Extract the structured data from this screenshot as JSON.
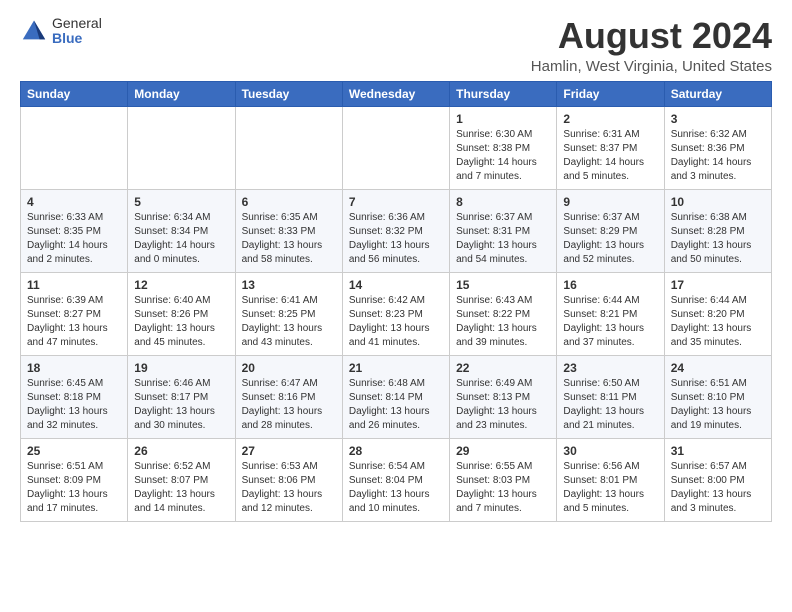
{
  "header": {
    "logo_general": "General",
    "logo_blue": "Blue",
    "month_title": "August 2024",
    "location": "Hamlin, West Virginia, United States"
  },
  "weekdays": [
    "Sunday",
    "Monday",
    "Tuesday",
    "Wednesday",
    "Thursday",
    "Friday",
    "Saturday"
  ],
  "weeks": [
    [
      {
        "day": "",
        "info": ""
      },
      {
        "day": "",
        "info": ""
      },
      {
        "day": "",
        "info": ""
      },
      {
        "day": "",
        "info": ""
      },
      {
        "day": "1",
        "info": "Sunrise: 6:30 AM\nSunset: 8:38 PM\nDaylight: 14 hours\nand 7 minutes."
      },
      {
        "day": "2",
        "info": "Sunrise: 6:31 AM\nSunset: 8:37 PM\nDaylight: 14 hours\nand 5 minutes."
      },
      {
        "day": "3",
        "info": "Sunrise: 6:32 AM\nSunset: 8:36 PM\nDaylight: 14 hours\nand 3 minutes."
      }
    ],
    [
      {
        "day": "4",
        "info": "Sunrise: 6:33 AM\nSunset: 8:35 PM\nDaylight: 14 hours\nand 2 minutes."
      },
      {
        "day": "5",
        "info": "Sunrise: 6:34 AM\nSunset: 8:34 PM\nDaylight: 14 hours\nand 0 minutes."
      },
      {
        "day": "6",
        "info": "Sunrise: 6:35 AM\nSunset: 8:33 PM\nDaylight: 13 hours\nand 58 minutes."
      },
      {
        "day": "7",
        "info": "Sunrise: 6:36 AM\nSunset: 8:32 PM\nDaylight: 13 hours\nand 56 minutes."
      },
      {
        "day": "8",
        "info": "Sunrise: 6:37 AM\nSunset: 8:31 PM\nDaylight: 13 hours\nand 54 minutes."
      },
      {
        "day": "9",
        "info": "Sunrise: 6:37 AM\nSunset: 8:29 PM\nDaylight: 13 hours\nand 52 minutes."
      },
      {
        "day": "10",
        "info": "Sunrise: 6:38 AM\nSunset: 8:28 PM\nDaylight: 13 hours\nand 50 minutes."
      }
    ],
    [
      {
        "day": "11",
        "info": "Sunrise: 6:39 AM\nSunset: 8:27 PM\nDaylight: 13 hours\nand 47 minutes."
      },
      {
        "day": "12",
        "info": "Sunrise: 6:40 AM\nSunset: 8:26 PM\nDaylight: 13 hours\nand 45 minutes."
      },
      {
        "day": "13",
        "info": "Sunrise: 6:41 AM\nSunset: 8:25 PM\nDaylight: 13 hours\nand 43 minutes."
      },
      {
        "day": "14",
        "info": "Sunrise: 6:42 AM\nSunset: 8:23 PM\nDaylight: 13 hours\nand 41 minutes."
      },
      {
        "day": "15",
        "info": "Sunrise: 6:43 AM\nSunset: 8:22 PM\nDaylight: 13 hours\nand 39 minutes."
      },
      {
        "day": "16",
        "info": "Sunrise: 6:44 AM\nSunset: 8:21 PM\nDaylight: 13 hours\nand 37 minutes."
      },
      {
        "day": "17",
        "info": "Sunrise: 6:44 AM\nSunset: 8:20 PM\nDaylight: 13 hours\nand 35 minutes."
      }
    ],
    [
      {
        "day": "18",
        "info": "Sunrise: 6:45 AM\nSunset: 8:18 PM\nDaylight: 13 hours\nand 32 minutes."
      },
      {
        "day": "19",
        "info": "Sunrise: 6:46 AM\nSunset: 8:17 PM\nDaylight: 13 hours\nand 30 minutes."
      },
      {
        "day": "20",
        "info": "Sunrise: 6:47 AM\nSunset: 8:16 PM\nDaylight: 13 hours\nand 28 minutes."
      },
      {
        "day": "21",
        "info": "Sunrise: 6:48 AM\nSunset: 8:14 PM\nDaylight: 13 hours\nand 26 minutes."
      },
      {
        "day": "22",
        "info": "Sunrise: 6:49 AM\nSunset: 8:13 PM\nDaylight: 13 hours\nand 23 minutes."
      },
      {
        "day": "23",
        "info": "Sunrise: 6:50 AM\nSunset: 8:11 PM\nDaylight: 13 hours\nand 21 minutes."
      },
      {
        "day": "24",
        "info": "Sunrise: 6:51 AM\nSunset: 8:10 PM\nDaylight: 13 hours\nand 19 minutes."
      }
    ],
    [
      {
        "day": "25",
        "info": "Sunrise: 6:51 AM\nSunset: 8:09 PM\nDaylight: 13 hours\nand 17 minutes."
      },
      {
        "day": "26",
        "info": "Sunrise: 6:52 AM\nSunset: 8:07 PM\nDaylight: 13 hours\nand 14 minutes."
      },
      {
        "day": "27",
        "info": "Sunrise: 6:53 AM\nSunset: 8:06 PM\nDaylight: 13 hours\nand 12 minutes."
      },
      {
        "day": "28",
        "info": "Sunrise: 6:54 AM\nSunset: 8:04 PM\nDaylight: 13 hours\nand 10 minutes."
      },
      {
        "day": "29",
        "info": "Sunrise: 6:55 AM\nSunset: 8:03 PM\nDaylight: 13 hours\nand 7 minutes."
      },
      {
        "day": "30",
        "info": "Sunrise: 6:56 AM\nSunset: 8:01 PM\nDaylight: 13 hours\nand 5 minutes."
      },
      {
        "day": "31",
        "info": "Sunrise: 6:57 AM\nSunset: 8:00 PM\nDaylight: 13 hours\nand 3 minutes."
      }
    ]
  ]
}
